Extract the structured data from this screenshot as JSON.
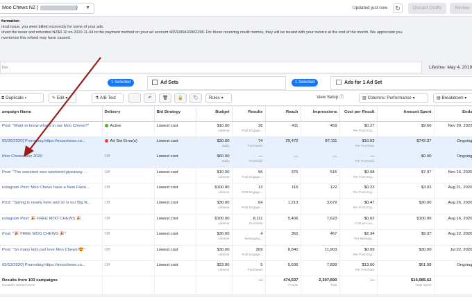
{
  "topbar": {
    "account_label": "Moo Chews NZ (",
    "account_suffix": ")",
    "updated_text": "Updated just now",
    "discard_label": "Discard Drafts",
    "review_label": "Review"
  },
  "notice": {
    "title": "formation",
    "line1": "nical issue, you were billed incorrectly for some of your ads.",
    "line2": "olved the issue and refunded NZ$0.10 on 2020-11-04 to the payment method on your ad account 4653289433902398. For those receiving credit memos, they will be issued with your invoice at the end of the month. We appreciate you",
    "line3": "nvenience this refund may have caused."
  },
  "filter": {
    "placeholder": "lter",
    "date_range": "Lifetime: May 4, 2019"
  },
  "tabs": {
    "selected_left": "1 Selected",
    "adsets_label": "Ad Sets",
    "selected_right": "1 Selected",
    "ads_label": "Ads for 1 Ad Set"
  },
  "toolbar": {
    "duplicate": "Duplicate",
    "edit": "Edit",
    "ab_test": "A/B Test",
    "rules": "Rules",
    "view_setup": "View Setup",
    "columns": "Columns: Performance",
    "breakdown": "Breakdown"
  },
  "columns": {
    "name": "ampaign Name",
    "delivery": "Delivery",
    "bid": "Bid Strategy",
    "budget": "Budget",
    "results": "Results",
    "reach": "Reach",
    "impressions": "Impressions",
    "cpr": "Cost per Result",
    "spent": "Amount Spent",
    "ends": "Ends"
  },
  "rows": [
    {
      "name": "Post: \"Want to know what's in our Moo Chews?\"",
      "delivery": "Active",
      "bid": "Lowest cost",
      "budget": "$10.00",
      "budget_sub": "Lifetime",
      "results": "36",
      "results_sub": "Post Engage...",
      "reach": "411",
      "impressions": "459",
      "cpr": "$0.27",
      "cpr_sub": "Per Post Eng...",
      "spent": "$9.66",
      "ends": "Nov 20, 2022"
    },
    {
      "name": "05/26/2020] Promoting https://moochews.co...",
      "delivery": "Ad Set Error(s)",
      "bid": "Lowest cost",
      "budget": "$30.00",
      "budget_sub": "Daily",
      "results": "74",
      "results_sub": "Purchases",
      "reach": "29,472",
      "impressions": "87,111",
      "cpr": "$10.03",
      "cpr_sub": "Per Purchase",
      "spent": "$742.37",
      "ends": "Ongoing"
    },
    {
      "name": "Moo Chews Nov 2020",
      "delivery": "Off",
      "bid": "Lowest cost",
      "budget": "$60.00",
      "budget_sub": "Daily",
      "results": "—",
      "results_sub": "Purchase",
      "reach": "—",
      "impressions": "—",
      "cpr": "—",
      "cpr_sub": "Per Purchase",
      "spent": "$0.00",
      "ends": "Ongoing"
    },
    {
      "name": "Post: \"The sweetest wee weekend giveaway ...",
      "delivery": "Off",
      "bid": "Lowest cost",
      "budget": "$10.00",
      "budget_sub": "Lifetime",
      "results": "95",
      "results_sub": "Post Engage...",
      "reach": "375",
      "impressions": "515",
      "cpr": "$0.08",
      "cpr_sub": "Per Post Eng...",
      "spent": "$7.97",
      "ends": "Nov 16, 2020"
    },
    {
      "name": "nstagram Post: Moo Chews have a New Flavo...",
      "delivery": "Off",
      "bid": "Lowest cost",
      "budget": "$100.00",
      "budget_sub": "Lifetime",
      "results": "13",
      "results_sub": "Post Engage...",
      "reach": "116",
      "impressions": "122",
      "cpr": "$0.23",
      "cpr_sub": "Per Post Eng...",
      "spent": "$3.03",
      "ends": "Aug 21, 2020"
    },
    {
      "name": "Post: \"Spring is nearly here and so is our Big N...",
      "delivery": "Off",
      "bid": "Lowest cost",
      "budget": "$30.00",
      "budget_sub": "Lifetime",
      "results": "64",
      "results_sub": "Post Engage...",
      "reach": "1,213",
      "impressions": "3,679",
      "cpr": "$0.47",
      "cpr_sub": "Per Post Eng...",
      "spent": "$30.00",
      "ends": "Aug 26, 2020"
    },
    {
      "name": "nstagram Post: 🎉 FREE MOO CHEWS 🎉",
      "delivery": "Off",
      "bid": "Lowest cost",
      "budget": "$100.00",
      "budget_sub": "Lifetime",
      "results": "8,111",
      "results_sub": "Purchase",
      "reach": "5,406",
      "impressions": "7,623",
      "cpr": "$0.02",
      "cpr_sub": "Cost per Lin...",
      "spent": "$100.00",
      "ends": "Aug 16, 2020"
    },
    {
      "name": "Post: \"🎉 FREE MOO CHEWS 🎉\"",
      "delivery": "Off",
      "bid": "Lowest cost",
      "budget": "$30.00",
      "budget_sub": "Lifetime",
      "results": "4",
      "results_sub": "Messaging...",
      "reach": "362",
      "impressions": "467",
      "cpr": "$2.34",
      "cpr_sub": "Per Messagi...",
      "spent": "$9.37",
      "ends": "Aug 12, 2020"
    },
    {
      "name": "Post: \"So many kids just love Moo Chews!😍\"",
      "delivery": "Off",
      "bid": "Lowest cost",
      "budget": "$30.00",
      "budget_sub": "Lifetime",
      "results": "369",
      "results_sub": "Post Engage...",
      "reach": "8,840",
      "impressions": "11,903",
      "cpr": "$0.09",
      "cpr_sub": "Per Post Eng...",
      "spent": "$30.00",
      "ends": "Jul 22, 2020"
    },
    {
      "name": "05/13/2020] Promoting https://moochews.co...",
      "delivery": "Off",
      "bid": "Lowest cost",
      "budget": "$23.00",
      "budget_sub": "Lifetime",
      "results": "5",
      "results_sub": "Purchases",
      "reach": "5,636",
      "impressions": "7,899",
      "cpr": "$13.00",
      "cpr_sub": "Per Purchase",
      "spent": "$61.98",
      "ends": "Ongoing"
    }
  ],
  "totals": {
    "label": "Results from 103 campaigns",
    "sub": "Excludes deleted items",
    "results": "—",
    "reach": "474,537",
    "reach_sub": "People",
    "impressions": "2,307,690",
    "impressions_sub": "Total",
    "cpr": "—",
    "spent": "$16,085.62",
    "spent_sub": "Total Spent"
  },
  "colors": {
    "accent": "#1877f2",
    "active": "#42b72a",
    "error": "#fa3e3e",
    "annotation_arrow": "#9b1b1b"
  }
}
